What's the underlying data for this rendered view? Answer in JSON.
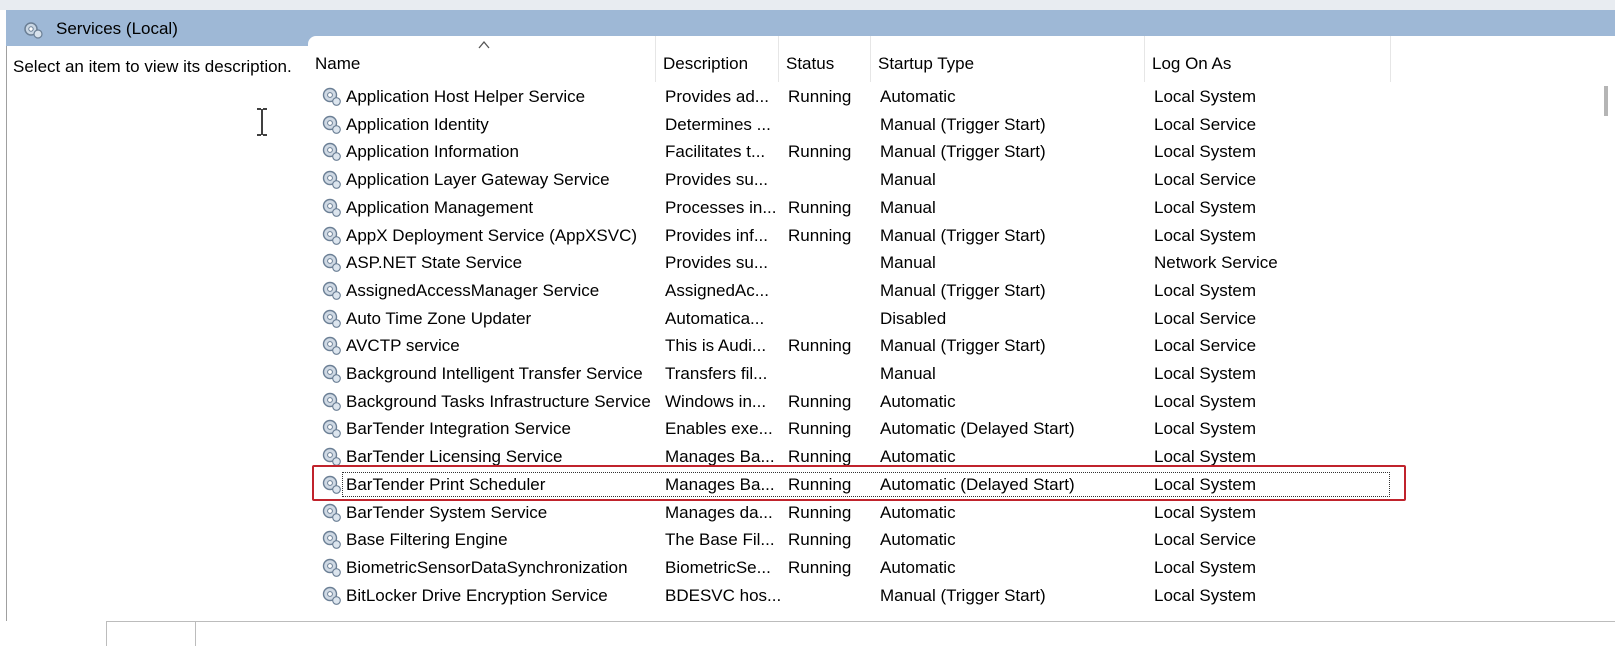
{
  "header": {
    "title": "Services (Local)",
    "icon": "services-gear-icon"
  },
  "left_pane": {
    "description": "Select an item to view its description."
  },
  "columns": {
    "name": "Name",
    "description": "Description",
    "status": "Status",
    "startup_type": "Startup Type",
    "log_on_as": "Log On As"
  },
  "rows": [
    {
      "name": "Application Host Helper Service",
      "description": "Provides ad...",
      "status": "Running",
      "startup": "Automatic",
      "logon": "Local System"
    },
    {
      "name": "Application Identity",
      "description": "Determines ...",
      "status": "",
      "startup": "Manual (Trigger Start)",
      "logon": "Local Service"
    },
    {
      "name": "Application Information",
      "description": "Facilitates t...",
      "status": "Running",
      "startup": "Manual (Trigger Start)",
      "logon": "Local System"
    },
    {
      "name": "Application Layer Gateway Service",
      "description": "Provides su...",
      "status": "",
      "startup": "Manual",
      "logon": "Local Service"
    },
    {
      "name": "Application Management",
      "description": "Processes in...",
      "status": "Running",
      "startup": "Manual",
      "logon": "Local System"
    },
    {
      "name": "AppX Deployment Service (AppXSVC)",
      "description": "Provides inf...",
      "status": "Running",
      "startup": "Manual (Trigger Start)",
      "logon": "Local System"
    },
    {
      "name": "ASP.NET State Service",
      "description": "Provides su...",
      "status": "",
      "startup": "Manual",
      "logon": "Network Service"
    },
    {
      "name": "AssignedAccessManager Service",
      "description": "AssignedAc...",
      "status": "",
      "startup": "Manual (Trigger Start)",
      "logon": "Local System"
    },
    {
      "name": "Auto Time Zone Updater",
      "description": "Automatica...",
      "status": "",
      "startup": "Disabled",
      "logon": "Local Service"
    },
    {
      "name": "AVCTP service",
      "description": "This is Audi...",
      "status": "Running",
      "startup": "Manual (Trigger Start)",
      "logon": "Local Service"
    },
    {
      "name": "Background Intelligent Transfer Service",
      "description": "Transfers fil...",
      "status": "",
      "startup": "Manual",
      "logon": "Local System"
    },
    {
      "name": "Background Tasks Infrastructure Service",
      "description": "Windows in...",
      "status": "Running",
      "startup": "Automatic",
      "logon": "Local System"
    },
    {
      "name": "BarTender Integration Service",
      "description": "Enables exe...",
      "status": "Running",
      "startup": "Automatic (Delayed Start)",
      "logon": "Local System"
    },
    {
      "name": "BarTender Licensing Service",
      "description": "Manages Ba...",
      "status": "Running",
      "startup": "Automatic",
      "logon": "Local System"
    },
    {
      "name": "BarTender Print Scheduler",
      "description": "Manages Ba...",
      "status": "Running",
      "startup": "Automatic (Delayed Start)",
      "logon": "Local System",
      "selected": true
    },
    {
      "name": "BarTender System Service",
      "description": "Manages da...",
      "status": "Running",
      "startup": "Automatic",
      "logon": "Local System"
    },
    {
      "name": "Base Filtering Engine",
      "description": "The Base Fil...",
      "status": "Running",
      "startup": "Automatic",
      "logon": "Local Service"
    },
    {
      "name": "BiometricSensorDataSynchronization",
      "description": "BiometricSe...",
      "status": "Running",
      "startup": "Automatic",
      "logon": "Local System"
    },
    {
      "name": "BitLocker Drive Encryption Service",
      "description": "BDESVC hos...",
      "status": "",
      "startup": "Manual (Trigger Start)",
      "logon": "Local System"
    }
  ],
  "colors": {
    "header_bg": "#9eb8d6",
    "highlight_border": "#c0232c"
  }
}
